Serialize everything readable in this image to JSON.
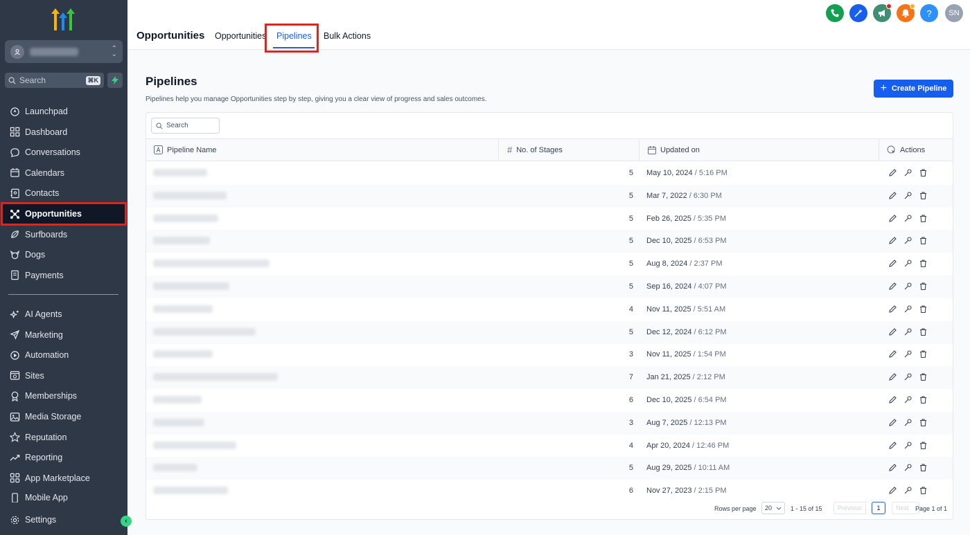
{
  "sidebar": {
    "search": {
      "placeholder": "Search",
      "shortcut": "⌘K"
    },
    "items": [
      {
        "label": "Launchpad",
        "icon": "launchpad-icon"
      },
      {
        "label": "Dashboard",
        "icon": "dashboard-icon"
      },
      {
        "label": "Conversations",
        "icon": "chat-icon"
      },
      {
        "label": "Calendars",
        "icon": "calendar-icon"
      },
      {
        "label": "Contacts",
        "icon": "contacts-icon"
      },
      {
        "label": "Opportunities",
        "icon": "opportunities-icon",
        "active": true
      },
      {
        "label": "Surfboards",
        "icon": "surfboard-icon"
      },
      {
        "label": "Dogs",
        "icon": "dog-icon"
      },
      {
        "label": "Payments",
        "icon": "payments-icon"
      }
    ],
    "items2": [
      {
        "label": "AI Agents",
        "icon": "sparkle-icon"
      },
      {
        "label": "Marketing",
        "icon": "send-icon"
      },
      {
        "label": "Automation",
        "icon": "automation-icon"
      },
      {
        "label": "Sites",
        "icon": "sites-icon"
      },
      {
        "label": "Memberships",
        "icon": "badge-icon"
      },
      {
        "label": "Media Storage",
        "icon": "image-icon"
      },
      {
        "label": "Reputation",
        "icon": "star-icon"
      },
      {
        "label": "Reporting",
        "icon": "trend-icon"
      },
      {
        "label": "App Marketplace",
        "icon": "apps-icon"
      },
      {
        "label": "Mobile App",
        "icon": "mobile-icon"
      }
    ],
    "settings": "Settings"
  },
  "header": {
    "title": "Opportunities",
    "tabs": [
      {
        "label": "Opportunities"
      },
      {
        "label": "Pipelines",
        "active": true
      },
      {
        "label": "Bulk Actions"
      }
    ],
    "icons": [
      {
        "name": "phone-icon",
        "color": "#12a150"
      },
      {
        "name": "magic-icon",
        "color": "#155eef"
      },
      {
        "name": "megaphone-icon",
        "color": "#3f8f74"
      },
      {
        "name": "bell-icon",
        "color": "#f97316"
      },
      {
        "name": "help-icon",
        "color": "#2e90fa"
      }
    ],
    "avatar": "SN"
  },
  "main": {
    "title": "Pipelines",
    "description": "Pipelines help you manage Opportunities step by step, giving you a clear view of progress and sales outcomes.",
    "create_label": "Create Pipeline",
    "search_placeholder": "Search",
    "columns": [
      "Pipeline Name",
      "No. of Stages",
      "Updated on",
      "Actions"
    ],
    "rows": [
      {
        "stages": "5",
        "date": "May 10, 2024",
        "time": "5:16 PM"
      },
      {
        "stages": "5",
        "date": "Mar 7, 2022",
        "time": "6:30 PM"
      },
      {
        "stages": "5",
        "date": "Feb 26, 2025",
        "time": "5:35 PM"
      },
      {
        "stages": "5",
        "date": "Dec 10, 2025",
        "time": "6:53 PM"
      },
      {
        "stages": "5",
        "date": "Aug 8, 2024",
        "time": "2:37 PM"
      },
      {
        "stages": "5",
        "date": "Sep 16, 2024",
        "time": "4:07 PM"
      },
      {
        "stages": "4",
        "date": "Nov 11, 2025",
        "time": "5:51 AM"
      },
      {
        "stages": "5",
        "date": "Dec 12, 2024",
        "time": "6:12 PM"
      },
      {
        "stages": "3",
        "date": "Nov 11, 2025",
        "time": "1:54 PM"
      },
      {
        "stages": "7",
        "date": "Jan 21, 2025",
        "time": "2:12 PM"
      },
      {
        "stages": "6",
        "date": "Dec 10, 2025",
        "time": "6:54 PM"
      },
      {
        "stages": "3",
        "date": "Aug 7, 2025",
        "time": "12:13 PM"
      },
      {
        "stages": "4",
        "date": "Apr 20, 2024",
        "time": "12:46 PM"
      },
      {
        "stages": "5",
        "date": "Aug 29, 2025",
        "time": "10:11 AM"
      },
      {
        "stages": "6",
        "date": "Nov 27, 2023",
        "time": "2:15 PM"
      }
    ],
    "pagination": {
      "rows_per_page_label": "Rows per page",
      "rows_per_page": "20",
      "range": "1 - 15 of 15",
      "previous": "Previous",
      "current": "1",
      "next": "Next",
      "page_of": "Page 1 of 1"
    }
  }
}
